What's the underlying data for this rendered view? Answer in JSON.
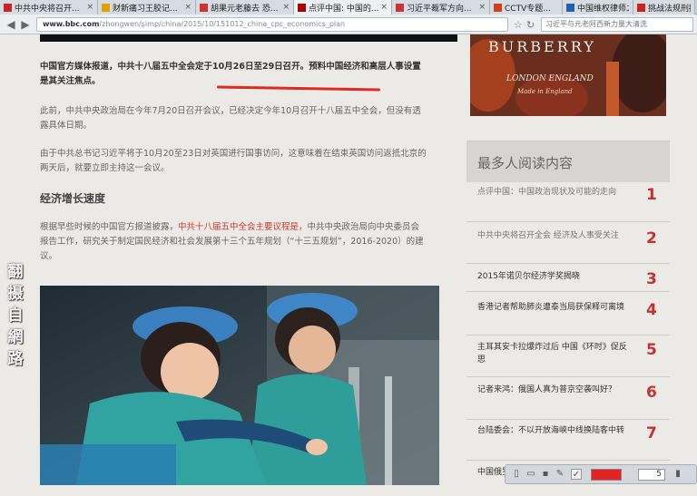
{
  "tabs": [
    {
      "title": "中共中央将召开...",
      "favicon_color": "#cc2222"
    },
    {
      "title": "财新痛习王胶记...",
      "favicon_color": "#e0a000"
    },
    {
      "title": "胡果元老藤去 恐...",
      "favicon_color": "#d03030"
    },
    {
      "title": "点评中国: 中国的...",
      "favicon_color": "#b00000"
    },
    {
      "title": "习近平裁军方向...",
      "favicon_color": "#cc3333"
    },
    {
      "title": "CCTV专题...",
      "favicon_color": "#d04020"
    },
    {
      "title": "中国维权律师之...",
      "favicon_color": "#2060b0"
    },
    {
      "title": "挑战法规刑拘律...",
      "favicon_color": "#cc2222"
    }
  ],
  "address_bar": {
    "url_host": "www.bbc.com",
    "url_path": "/zhongwen/simp/china/2015/10/151012_china_cpc_economics_plan",
    "search_placeholder": "习近平与元老阿西新力量大清洗"
  },
  "article": {
    "lead_black": "中国官方媒体报道，",
    "lead_red": "中共十八届五中全会定于10月26日至29日召开。",
    "lead_tail": "预料中国经济和高层人事设置是其关注焦点。",
    "para2_a": "此前，中共中央政治局在今年7月20日召开会议，已经决定今年10月召开十八届五中全会，但没有透露具体日期。",
    "para3_a": "由于中共总书记习近平将于10月20至23日对英国进行国事访问，这意味着在结束英国访问返抵北京的两天后，就要立即主持这一会议。",
    "heading": "经济增长速度",
    "para5_a": "根据早些时候的中国官方报道披露，",
    "para5_red": "中共十八届五中全会主要议程是，",
    "para5_b": "中共中央政治局向中央委员会报告工作，研究关于制定国民经济和社会发展第十三个五年规划（“十三五规划”，2016-2020）的建议。",
    "watermark": "翻摄自網路"
  },
  "ad": {
    "brand": "BURBERRY",
    "line1": "LONDON ENGLAND",
    "line2": "Made in England"
  },
  "popular": {
    "title": "最多人阅读内容",
    "items": [
      {
        "rank": "1",
        "text": "点评中国：中国政治现状及可能的走向"
      },
      {
        "rank": "2",
        "text": "中共中央将召开全会 经济及人事受关注"
      },
      {
        "rank": "3",
        "text": "2015年诺贝尔经济学奖揭晓"
      },
      {
        "rank": "4",
        "text": "香港记者帮助肺炎遭泰当局获保释可离境"
      },
      {
        "rank": "5",
        "text": "主耳其安卡拉爆炸过后 中国《环时》促反思"
      },
      {
        "rank": "6",
        "text": "记者来鸿：俄国人真为普京空袭叫好？"
      },
      {
        "rank": "7",
        "text": "台陆委会：不以开放海峡中线换陆客中转"
      },
      {
        "rank": "8",
        "text": "中国俄罗斯"
      }
    ]
  },
  "toolbar": {
    "size_value": "5",
    "pen_color": "#e52222"
  }
}
